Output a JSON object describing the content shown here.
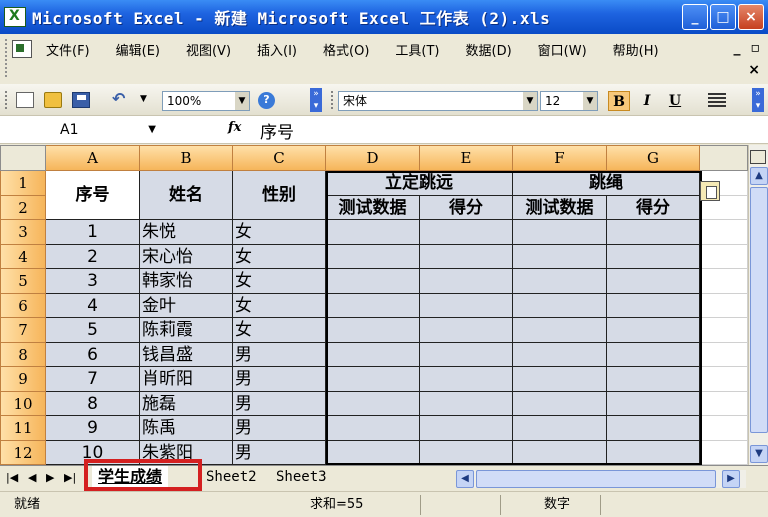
{
  "window": {
    "title": "Microsoft Excel - 新建 Microsoft Excel 工作表 (2).xls",
    "minimize": "_",
    "maximize": "□",
    "close": "×"
  },
  "menu": {
    "items": [
      "文件(F)",
      "编辑(E)",
      "视图(V)",
      "插入(I)",
      "格式(O)",
      "工具(T)",
      "数据(D)",
      "窗口(W)",
      "帮助(H)"
    ],
    "doc_min": "_",
    "doc_restore": "▫",
    "doc_close": "×"
  },
  "toolbar": {
    "zoom": "100%",
    "font_name": "宋体",
    "font_size": "12",
    "bold": "B",
    "italic": "I",
    "underline": "U",
    "help": "?"
  },
  "formula_bar": {
    "name_box": "A1",
    "fx": "fx",
    "content": "序号"
  },
  "grid": {
    "columns": [
      "A",
      "B",
      "C",
      "D",
      "E",
      "F",
      "G",
      ""
    ],
    "rows": [
      "1",
      "2",
      "3",
      "4",
      "5",
      "6",
      "7",
      "8",
      "9",
      "10",
      "11",
      "12"
    ],
    "header": {
      "seq": "序号",
      "name": "姓名",
      "gender": "性别",
      "long_jump": "立定跳远",
      "rope": "跳绳",
      "test_data_1": "测试数据",
      "score_1": "得分",
      "test_data_2": "测试数据",
      "score_2": "得分"
    },
    "data": [
      {
        "seq": "1",
        "name": "朱悦",
        "gender": "女"
      },
      {
        "seq": "2",
        "name": "宋心怡",
        "gender": "女"
      },
      {
        "seq": "3",
        "name": "韩家怡",
        "gender": "女"
      },
      {
        "seq": "4",
        "name": "金叶",
        "gender": "女"
      },
      {
        "seq": "5",
        "name": "陈莉霞",
        "gender": "女"
      },
      {
        "seq": "6",
        "name": "钱昌盛",
        "gender": "男"
      },
      {
        "seq": "7",
        "name": "肖昕阳",
        "gender": "男"
      },
      {
        "seq": "8",
        "name": "施磊",
        "gender": "男"
      },
      {
        "seq": "9",
        "name": "陈禹",
        "gender": "男"
      },
      {
        "seq": "10",
        "name": "朱紫阳",
        "gender": "男"
      }
    ]
  },
  "sheets": {
    "tabs": [
      "学生成绩",
      "Sheet2",
      "Sheet3"
    ],
    "active": "学生成绩"
  },
  "status": {
    "ready": "就绪",
    "sum": "求和=55",
    "numlock": "数字"
  }
}
